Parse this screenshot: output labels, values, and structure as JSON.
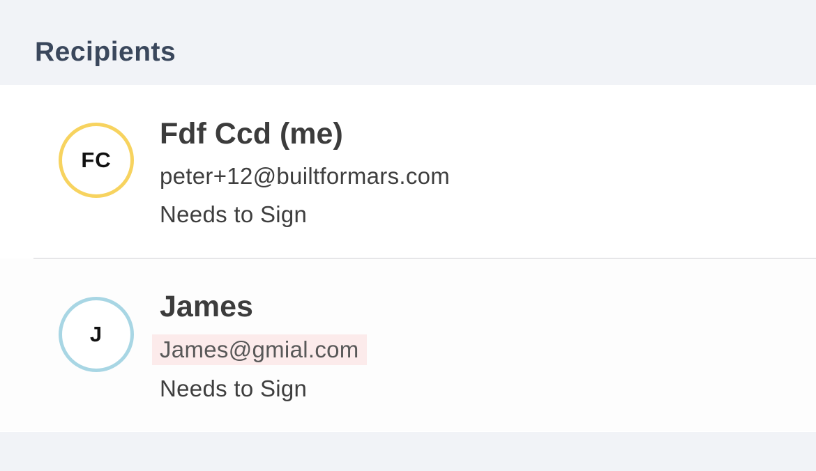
{
  "section": {
    "title": "Recipients"
  },
  "recipients": [
    {
      "initials": "FC",
      "name": "Fdf Ccd (me)",
      "email": "peter+12@builtformars.com",
      "status": "Needs to Sign",
      "avatar_color": "#f7d35f"
    },
    {
      "initials": "J",
      "name": "James",
      "email": "James@gmial.com",
      "status": "Needs to Sign",
      "avatar_color": "#a8d6e4",
      "email_highlight": "#fcebeb"
    }
  ]
}
